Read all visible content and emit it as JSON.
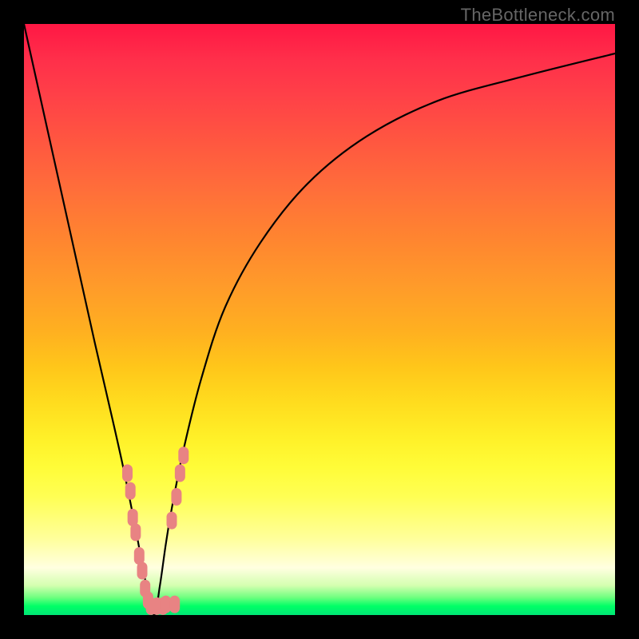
{
  "watermark": "TheBottleneck.com",
  "chart_data": {
    "type": "line",
    "title": "",
    "xlabel": "",
    "ylabel": "",
    "xlim": [
      0,
      100
    ],
    "ylim": [
      0,
      100
    ],
    "gradient_meaning": "background heat gradient: red (top / high bottleneck) → yellow → green (bottom / fit)",
    "series": [
      {
        "name": "bottleneck-curve",
        "x": [
          0,
          4,
          8,
          12,
          15,
          17,
          19,
          20.5,
          22,
          23,
          24,
          25,
          27,
          30,
          34,
          40,
          48,
          58,
          70,
          84,
          100
        ],
        "y": [
          100,
          82,
          64,
          46,
          33,
          24,
          14,
          6,
          0,
          5,
          12,
          18,
          28,
          40,
          52,
          63,
          73,
          81,
          87,
          91,
          95
        ]
      }
    ],
    "markers": {
      "name": "highlight-dots",
      "color": "#e88383",
      "points": [
        {
          "x": 17.5,
          "y": 24
        },
        {
          "x": 18.0,
          "y": 21
        },
        {
          "x": 18.4,
          "y": 16.5
        },
        {
          "x": 18.9,
          "y": 14
        },
        {
          "x": 19.5,
          "y": 10
        },
        {
          "x": 20.0,
          "y": 7.5
        },
        {
          "x": 20.5,
          "y": 4.5
        },
        {
          "x": 21.0,
          "y": 2.5
        },
        {
          "x": 21.5,
          "y": 1.5
        },
        {
          "x": 22.5,
          "y": 1.5
        },
        {
          "x": 23.5,
          "y": 1.5
        },
        {
          "x": 24.0,
          "y": 1.8
        },
        {
          "x": 25.5,
          "y": 1.8
        },
        {
          "x": 25.0,
          "y": 16
        },
        {
          "x": 25.8,
          "y": 20
        },
        {
          "x": 26.4,
          "y": 24
        },
        {
          "x": 27.0,
          "y": 27
        }
      ]
    }
  }
}
